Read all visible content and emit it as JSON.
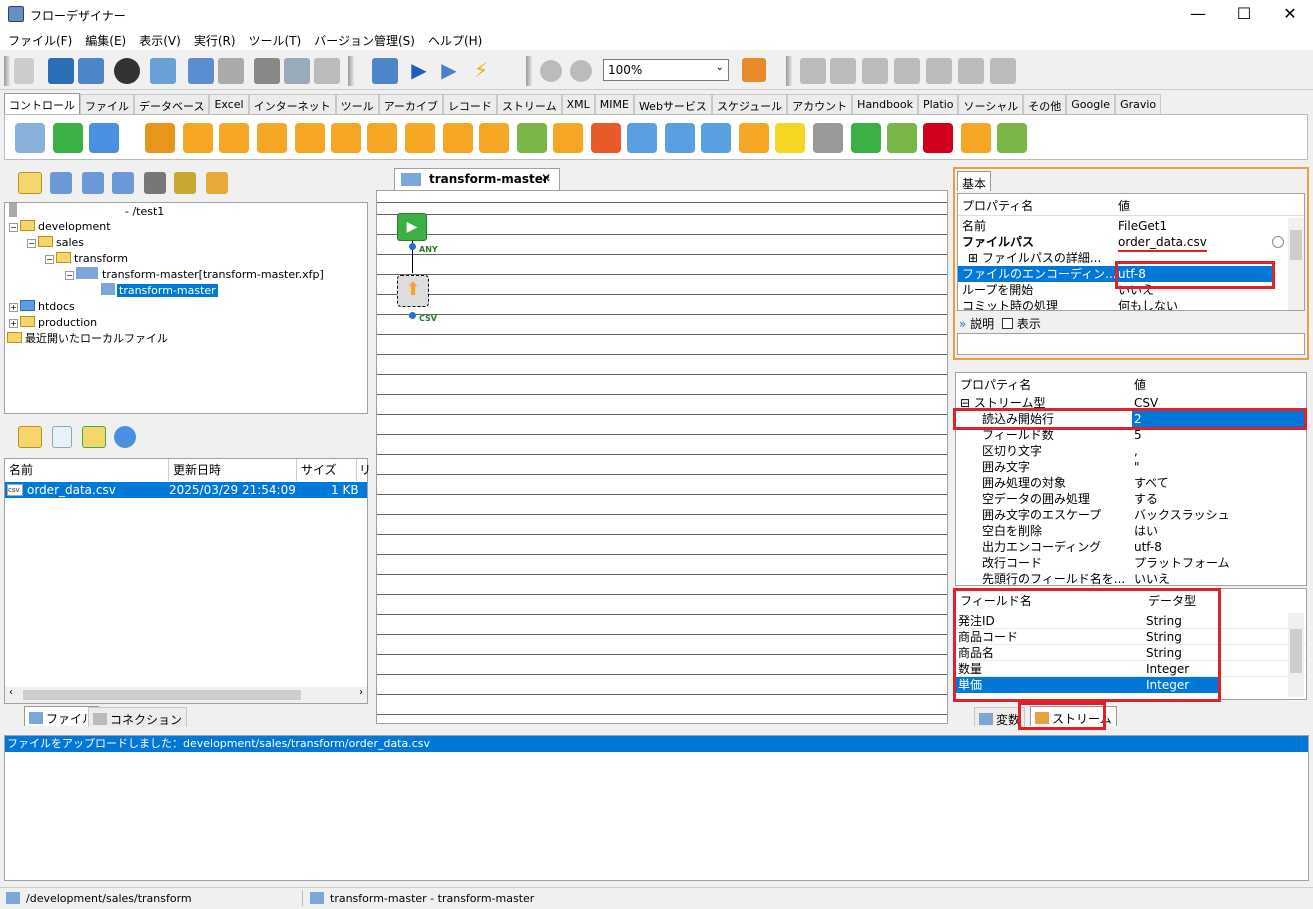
{
  "window": {
    "title": "フローデザイナー",
    "min": "—",
    "max": "☐",
    "close": "✕"
  },
  "menu": [
    "ファイル(F)",
    "編集(E)",
    "表示(V)",
    "実行(R)",
    "ツール(T)",
    "バージョン管理(S)",
    "ヘルプ(H)"
  ],
  "toolbar": {
    "zoom": "100%"
  },
  "palette_tabs": [
    "コントロール",
    "ファイル",
    "データベース",
    "Excel",
    "インターネット",
    "ツール",
    "アーカイブ",
    "レコード",
    "ストリーム",
    "XML",
    "MIME",
    "Webサービス",
    "スケジュール",
    "アカウント",
    "Handbook",
    "Platio",
    "ソーシャル",
    "その他",
    "Google",
    "Gravio"
  ],
  "tree": {
    "root": "- /test1",
    "development": "development",
    "sales": "sales",
    "transform": "transform",
    "xfp": "transform-master[transform-master.xfp]",
    "flow": "transform-master",
    "htdocs": "htdocs",
    "production": "production",
    "recent": "最近開いたローカルファイル"
  },
  "files": {
    "headers": [
      "名前",
      "更新日時",
      "サイズ",
      "リ"
    ],
    "rows": [
      {
        "name": "order_data.csv",
        "date": "2025/03/29 21:54:09",
        "size": "1 KB"
      }
    ]
  },
  "left_tabs": {
    "file": "ファイル",
    "connection": "コネクション"
  },
  "editor": {
    "tab": "transform-master",
    "close": "✕",
    "any_label": "ANY",
    "csv_label": "CSV"
  },
  "props_top": {
    "tab": "基本",
    "col_name": "プロパティ名",
    "col_value": "値",
    "rows": [
      {
        "k": "名前",
        "v": "FileGet1"
      },
      {
        "k": "ファイルパス",
        "v": "order_data.csv"
      },
      {
        "k": "⊞ ファイルパスの詳細...",
        "v": ""
      },
      {
        "k": "ファイルのエンコーディン...",
        "v": "utf-8"
      },
      {
        "k": "ループを開始",
        "v": "いいえ"
      },
      {
        "k": "コミット時の処理",
        "v": "何もしない"
      }
    ],
    "desc_label": "説明",
    "show_label": "表示"
  },
  "props_stream": {
    "col_name": "プロパティ名",
    "col_value": "値",
    "rows": [
      {
        "k": "⊟ ストリーム型",
        "v": "CSV"
      },
      {
        "k": "読込み開始行",
        "v": "2"
      },
      {
        "k": "フィールド数",
        "v": "5"
      },
      {
        "k": "区切り文字",
        "v": ","
      },
      {
        "k": "囲み文字",
        "v": "\""
      },
      {
        "k": "囲み処理の対象",
        "v": "すべて"
      },
      {
        "k": "空データの囲み処理",
        "v": "する"
      },
      {
        "k": "囲み文字のエスケープ",
        "v": "バックスラッシュ"
      },
      {
        "k": "空白を削除",
        "v": "はい"
      },
      {
        "k": "出力エンコーディング",
        "v": "utf-8"
      },
      {
        "k": "改行コード",
        "v": "プラットフォーム"
      },
      {
        "k": "先頭行のフィールド名を...",
        "v": "いいえ"
      }
    ]
  },
  "fields": {
    "col_name": "フィールド名",
    "col_type": "データ型",
    "rows": [
      {
        "n": "発注ID",
        "t": "String"
      },
      {
        "n": "商品コード",
        "t": "String"
      },
      {
        "n": "商品名",
        "t": "String"
      },
      {
        "n": "数量",
        "t": "Integer"
      },
      {
        "n": "単価",
        "t": "Integer"
      }
    ]
  },
  "right_tabs": {
    "vars": "変数",
    "stream": "ストリーム"
  },
  "log": {
    "message": "ファイルをアップロードしました：development/sales/transform/order_data.csv"
  },
  "status": {
    "path": "/development/sales/transform",
    "flow": "transform-master - transform-master"
  }
}
